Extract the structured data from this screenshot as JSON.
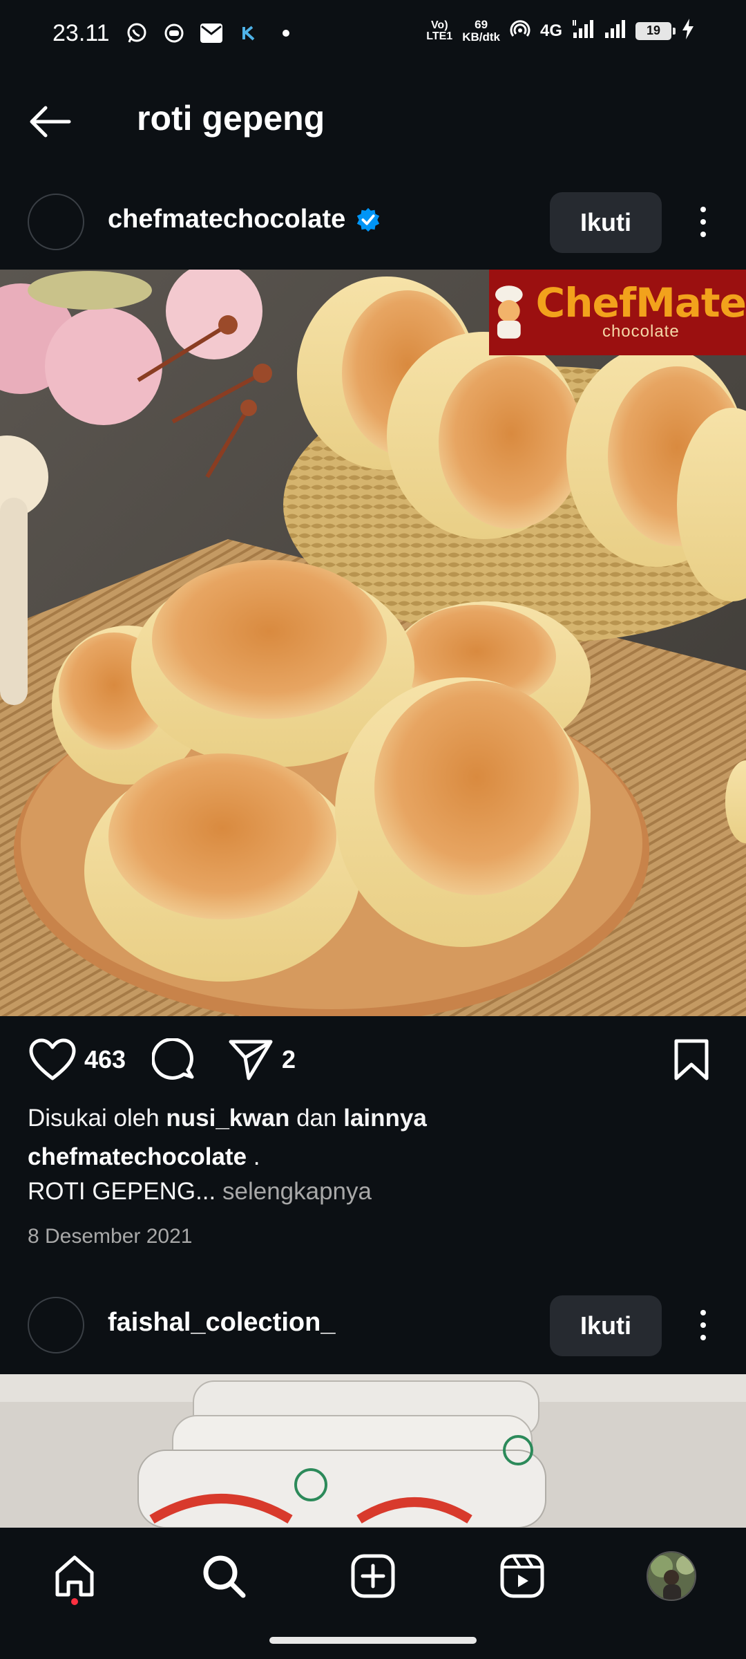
{
  "status_bar": {
    "time": "23.11",
    "volte_top": "Vo)",
    "volte_bottom": "LTE1",
    "speed_value": "69",
    "speed_unit": "KB/dtk",
    "network": "4G",
    "battery": "19"
  },
  "header": {
    "title": "roti gepeng"
  },
  "posts": [
    {
      "username": "chefmatechocolate",
      "verified": true,
      "follow_label": "Ikuti",
      "brand_name": "ChefMate",
      "brand_sub": "chocolate",
      "likes_count": "463",
      "shares_count": "2",
      "liked_by_prefix": "Disukai oleh",
      "liked_by_user": "nusi_kwan",
      "liked_by_mid": "dan",
      "liked_by_suffix": "lainnya",
      "caption_user": "chefmatechocolate",
      "caption_user_suffix": " .",
      "caption_text": "ROTI GEPENG...",
      "caption_more": " selengkapnya",
      "date": "8 Desember 2021"
    },
    {
      "username": "faishal_colection_",
      "follow_label": "Ikuti"
    }
  ],
  "icons": {
    "back": "arrow-left-icon",
    "like": "heart-icon",
    "comment": "comment-icon",
    "share": "send-icon",
    "save": "bookmark-icon",
    "home": "home-icon",
    "search": "search-icon",
    "create": "plus-square-icon",
    "reels": "reels-icon"
  },
  "colors": {
    "background": "#0c1014",
    "verified_blue": "#0095f6",
    "follow_button_bg": "#262a30",
    "brand_red": "#9b1010",
    "brand_orange": "#f2a21c",
    "notification_dot": "#ff3040"
  }
}
